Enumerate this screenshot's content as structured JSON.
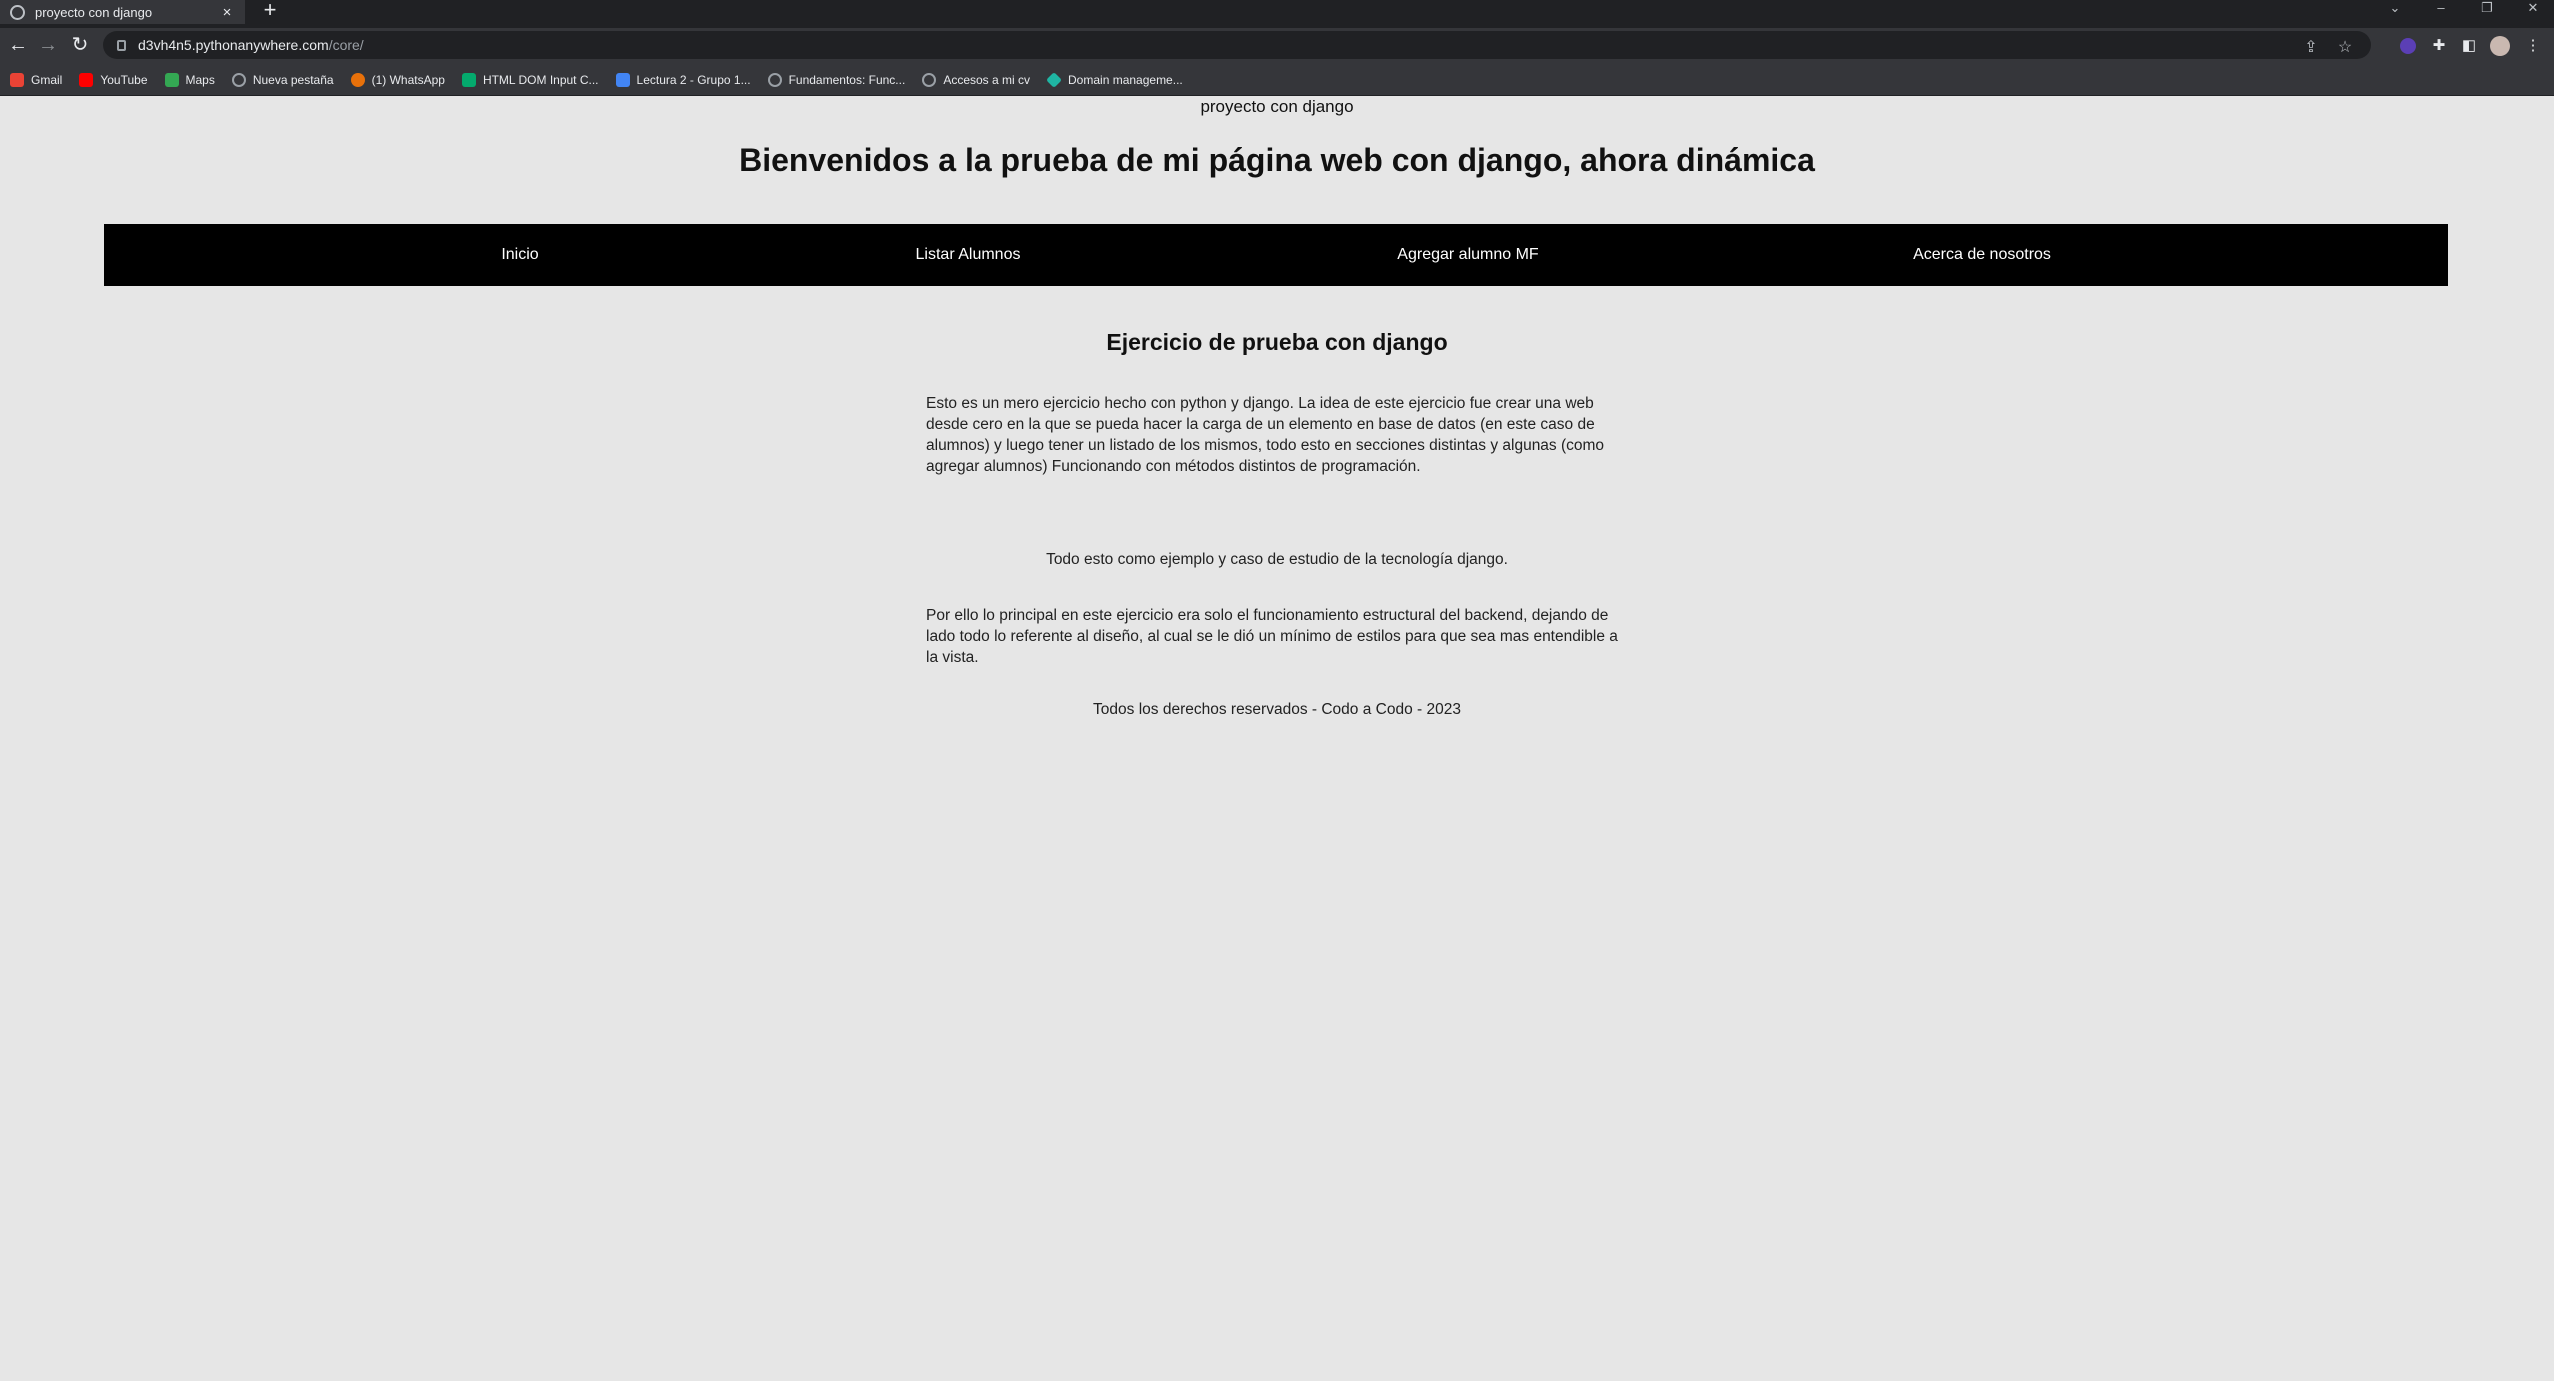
{
  "browser": {
    "tab_title": "proyecto con django",
    "new_tab_symbol": "+",
    "close_symbol": "×",
    "url_host": "d3vh4n5.pythonanywhere.com",
    "url_path": "/core/",
    "bookmarks": [
      {
        "label": "Gmail",
        "icon": "gmail-icon",
        "color": "#ea4335"
      },
      {
        "label": "YouTube",
        "icon": "youtube-icon",
        "color": "#ff0000"
      },
      {
        "label": "Maps",
        "icon": "maps-icon",
        "color": "#34a853"
      },
      {
        "label": "Nueva pestaña",
        "icon": "globe-icon",
        "color": "#9aa0a6"
      },
      {
        "label": "(1) WhatsApp",
        "icon": "whatsapp-icon",
        "color": "#e8710a"
      },
      {
        "label": "HTML DOM Input C...",
        "icon": "w3schools-icon",
        "color": "#04aa6d"
      },
      {
        "label": "Lectura 2 - Grupo 1...",
        "icon": "docs-icon",
        "color": "#4285f4"
      },
      {
        "label": "Fundamentos: Func...",
        "icon": "globe-icon",
        "color": "#9aa0a6"
      },
      {
        "label": "Accesos a mi cv",
        "icon": "globe-icon",
        "color": "#9aa0a6"
      },
      {
        "label": "Domain manageme...",
        "icon": "domain-icon",
        "color": "#1fb5a3"
      }
    ]
  },
  "page": {
    "tagline": "proyecto con django",
    "title": "Bienvenidos a la prueba de mi página web con django, ahora dinámica",
    "nav": [
      "Inicio",
      "Listar Alumnos",
      "Agregar alumno MF",
      "Acerca de nosotros"
    ],
    "section_title": "Ejercicio de prueba con django",
    "paragraph1": "Esto es un mero ejercicio hecho con python y django. La idea de este ejercicio fue crear una web desde cero en la que se pueda hacer la carga de un elemento en base de datos (en este caso de alumnos) y luego tener un listado de los mismos, todo esto en secciones distintas y algunas (como agregar alumnos) Funcionando con métodos distintos de programación.",
    "paragraph2": "Todo esto como ejemplo y caso de estudio de la tecnología django.",
    "paragraph3": "Por ello lo principal en este ejercicio era solo el funcionamiento estructural del backend, dejando de lado todo lo referente al diseño, al cual se le dió un mínimo de estilos para que sea mas entendible a la vista.",
    "footer": "Todos los derechos reservados - Codo a Codo - 2023"
  }
}
